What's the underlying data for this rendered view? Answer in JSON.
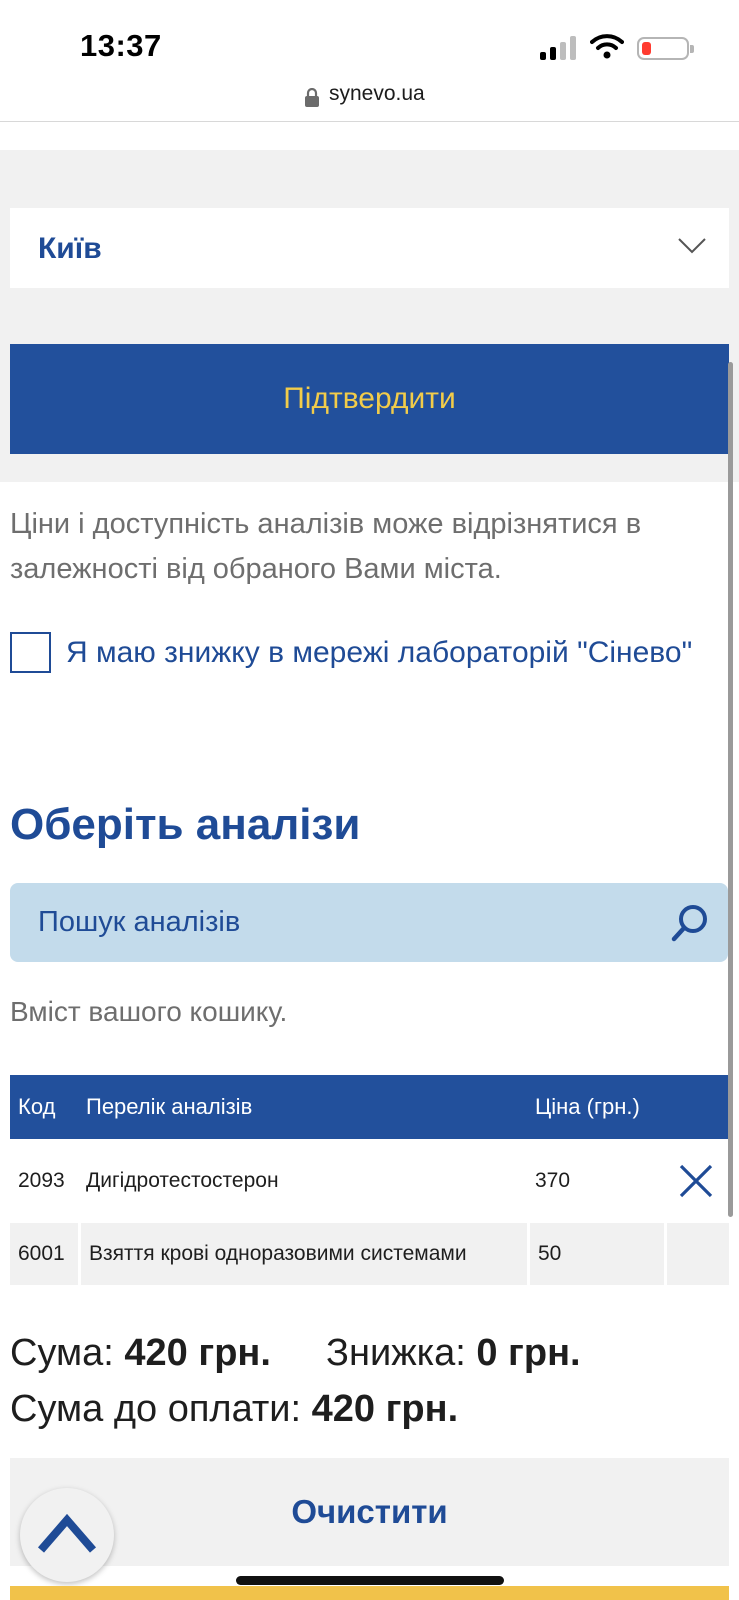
{
  "status_bar": {
    "time": "13:37"
  },
  "browser": {
    "url": "synevo.ua"
  },
  "location": {
    "city": "Київ",
    "confirm_label": "Підтвердити"
  },
  "note": "Ціни і доступність аналізів може відрізнятися в залежності від обраного Вами міста.",
  "discount_checkbox": {
    "label": "Я маю знижку в мережі лабораторій \"Сінево\"",
    "checked": false
  },
  "section_title": "Оберіть аналізи",
  "search": {
    "placeholder": "Пошук аналізів"
  },
  "cart": {
    "caption": "Вміст вашого кошику.",
    "headers": {
      "code": "Код",
      "name": "Перелік аналізів",
      "price": "Ціна (грн.)"
    },
    "rows": [
      {
        "code": "2093",
        "name": "Дигідротестостерон",
        "price": "370",
        "removable": true
      },
      {
        "code": "6001",
        "name": "Взяття крові одноразовими системами",
        "price": "50",
        "removable": false
      }
    ]
  },
  "totals": {
    "sum_label": "Сума:",
    "sum_value": "420 грн.",
    "discount_label": "Знижка:",
    "discount_value": "0 грн.",
    "pay_label": "Сума до оплати:",
    "pay_value": "420 грн."
  },
  "clear_label": "Очистити",
  "colors": {
    "brand_blue": "#22509c",
    "accent_yellow": "#f2cc4a",
    "search_bg": "#c3dbeb"
  }
}
